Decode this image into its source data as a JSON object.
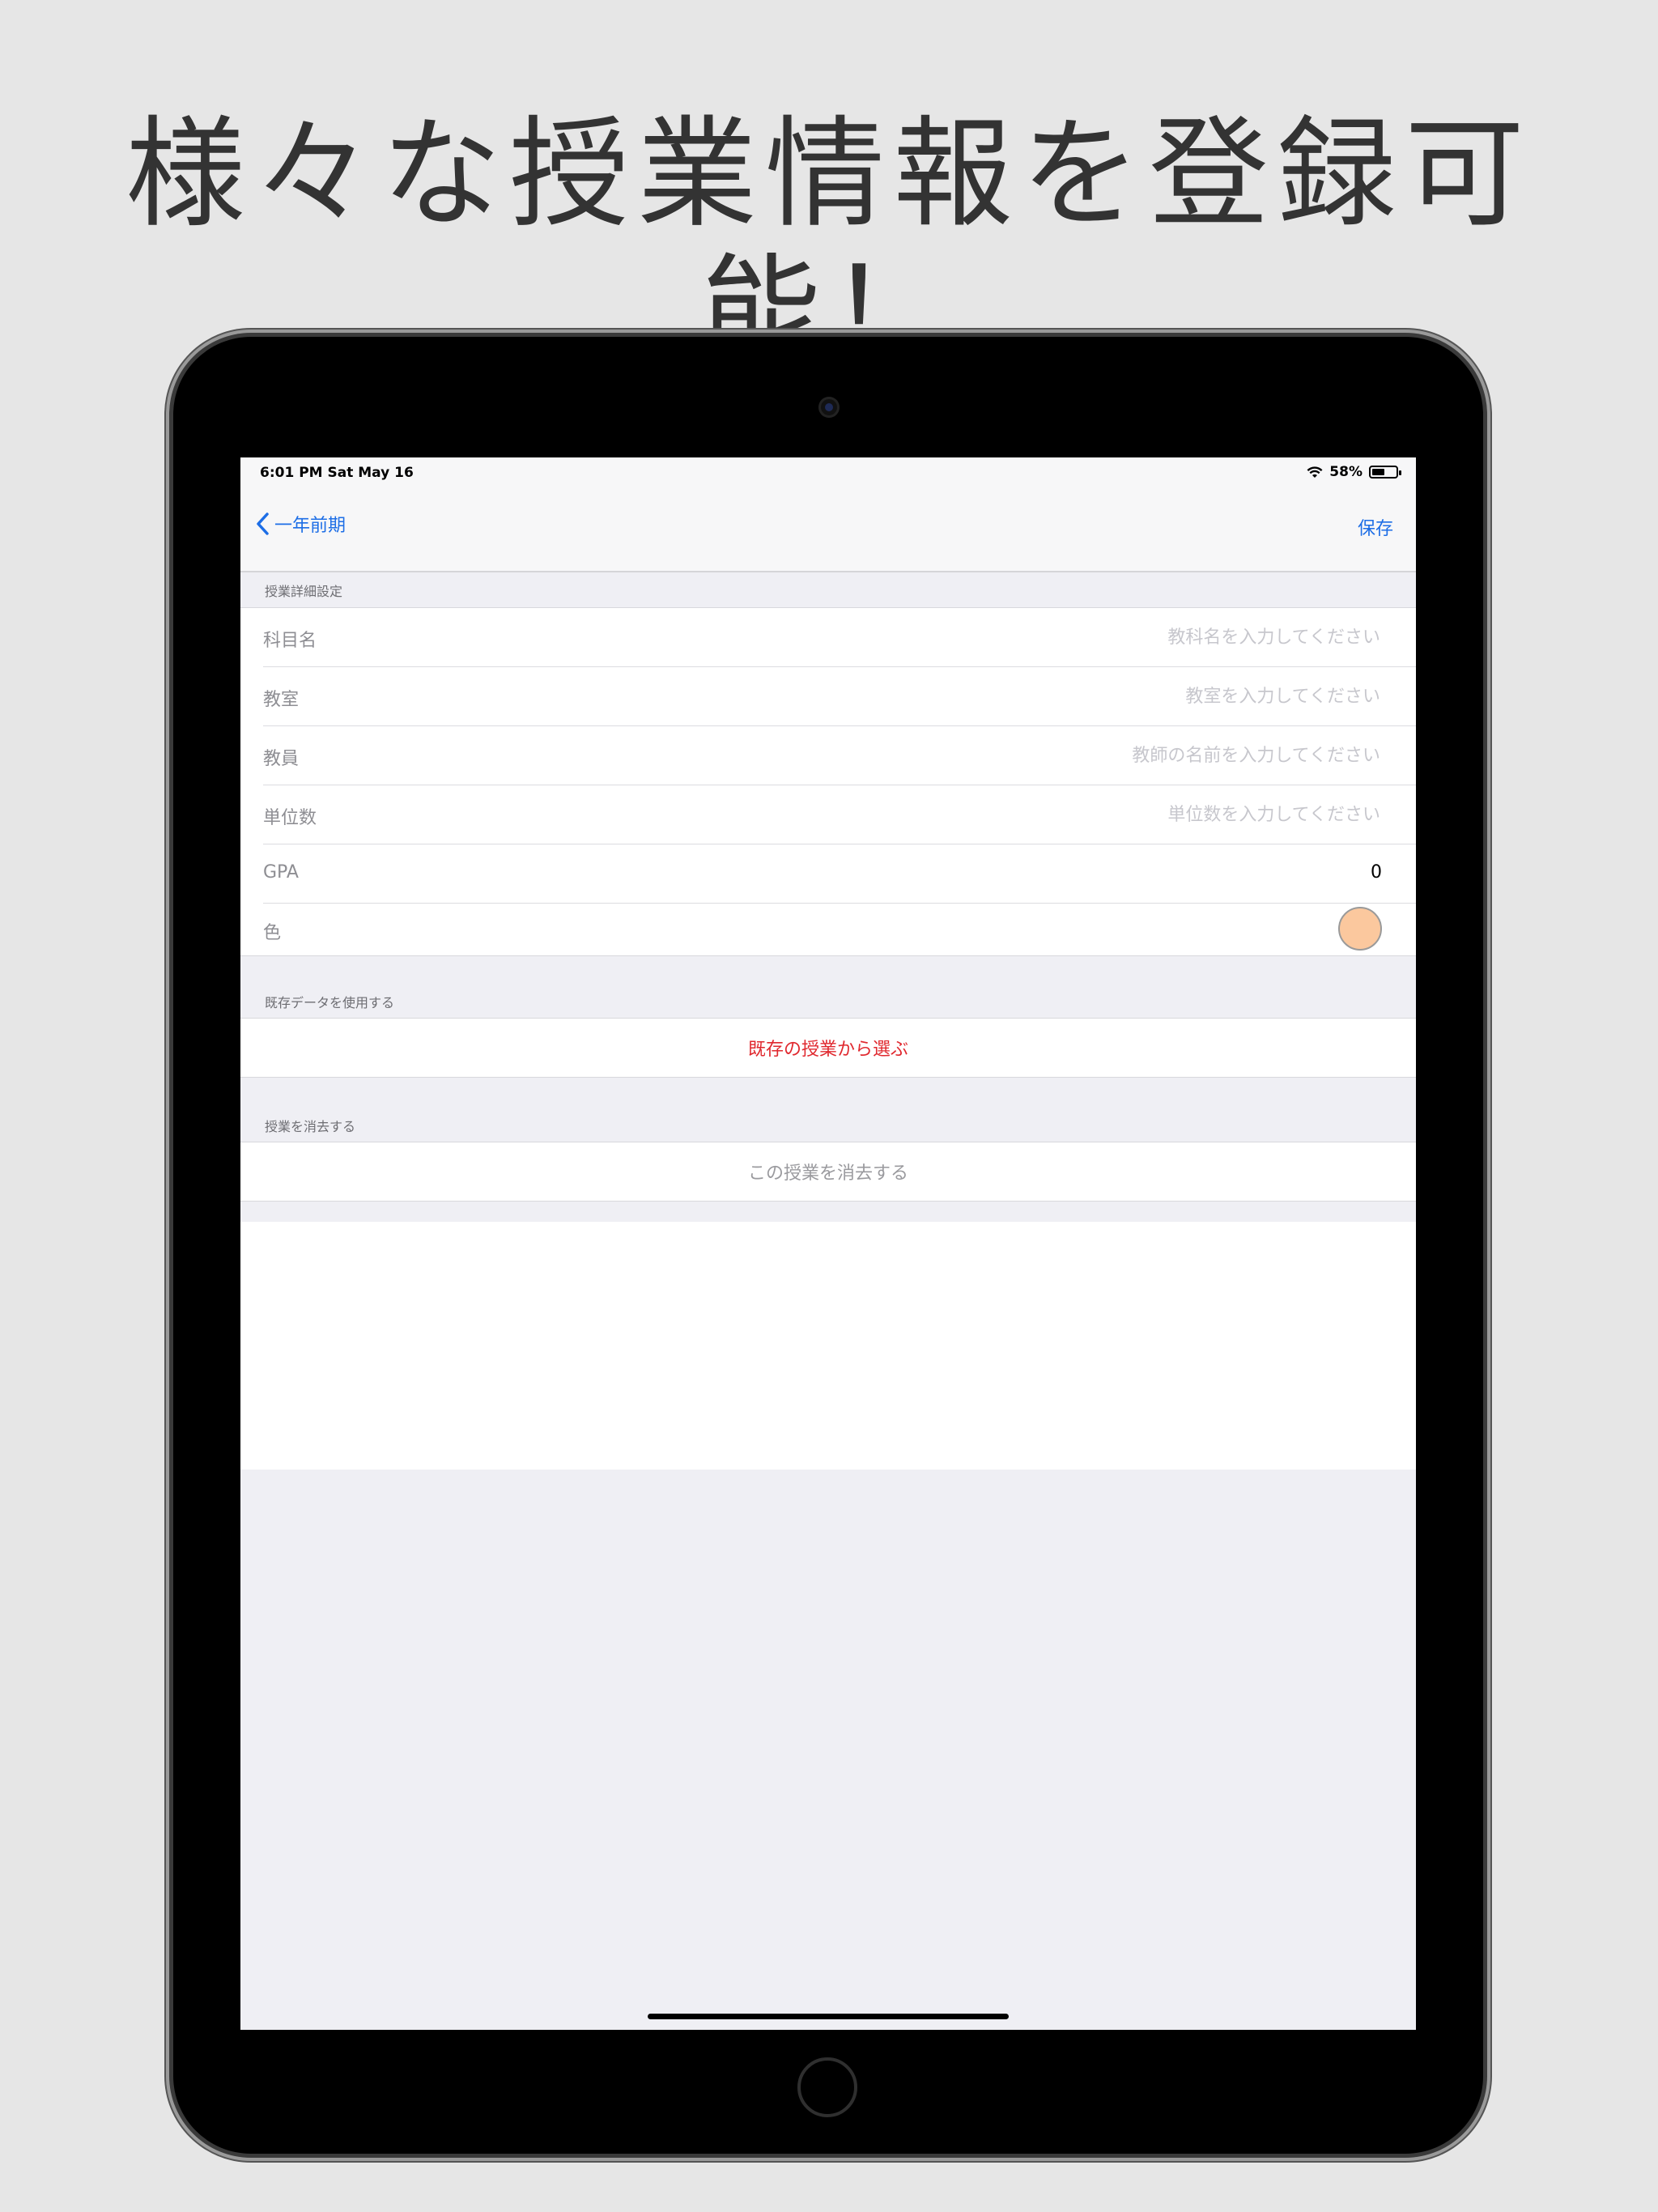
{
  "headline": "様々な授業情報を登録可能！",
  "status_bar": {
    "time_date": "6:01 PM   Sat May 16",
    "battery": "58%",
    "battery_level": 0.58
  },
  "nav": {
    "back_label": "一年前期",
    "save_label": "保存"
  },
  "sections": {
    "details": {
      "header": "授業詳細設定",
      "rows": [
        {
          "label": "科目名",
          "placeholder": "教科名を入力してください"
        },
        {
          "label": "教室",
          "placeholder": "教室を入力してください"
        },
        {
          "label": "教員",
          "placeholder": "教師の名前を入力してください"
        },
        {
          "label": "単位数",
          "placeholder": "単位数を入力してください"
        }
      ],
      "gpa_label": "GPA",
      "gpa_value": "0",
      "color_label": "色",
      "color_value": "#fbc89e"
    },
    "existing": {
      "header": "既存データを使用する",
      "action": "既存の授業から選ぶ",
      "action_color": "#e0282e"
    },
    "delete": {
      "header": "授業を消去する",
      "action": "この授業を消去する",
      "action_color": "#9a9a9e"
    }
  },
  "accent_color": "#1d6ee6"
}
